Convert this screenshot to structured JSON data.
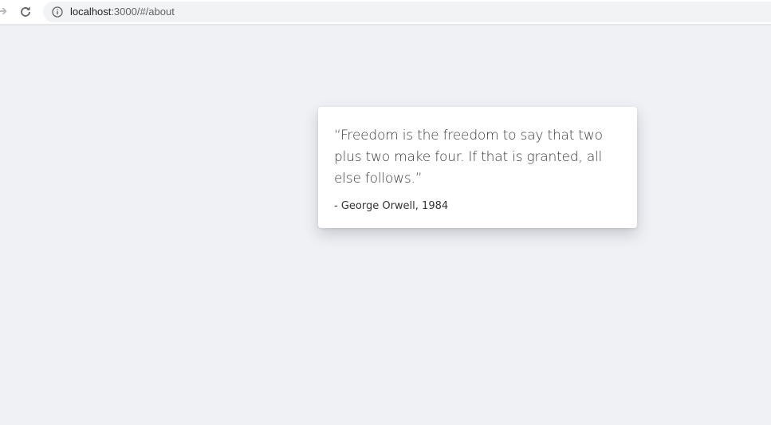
{
  "browser": {
    "url_host": "localhost",
    "url_path": ":3000/#/about",
    "icons": {
      "forward": "arrow-right-icon",
      "reload": "reload-icon",
      "site_info": "info-icon"
    }
  },
  "quote": {
    "text": "“Freedom is the freedom to say that two plus two make four. If that is granted, all else follows.”",
    "attribution": "- George Orwell, 1984"
  },
  "colors": {
    "page_background": "#eff1f5",
    "card_background": "#ffffff",
    "omnibox_background": "#f1f3f4"
  }
}
